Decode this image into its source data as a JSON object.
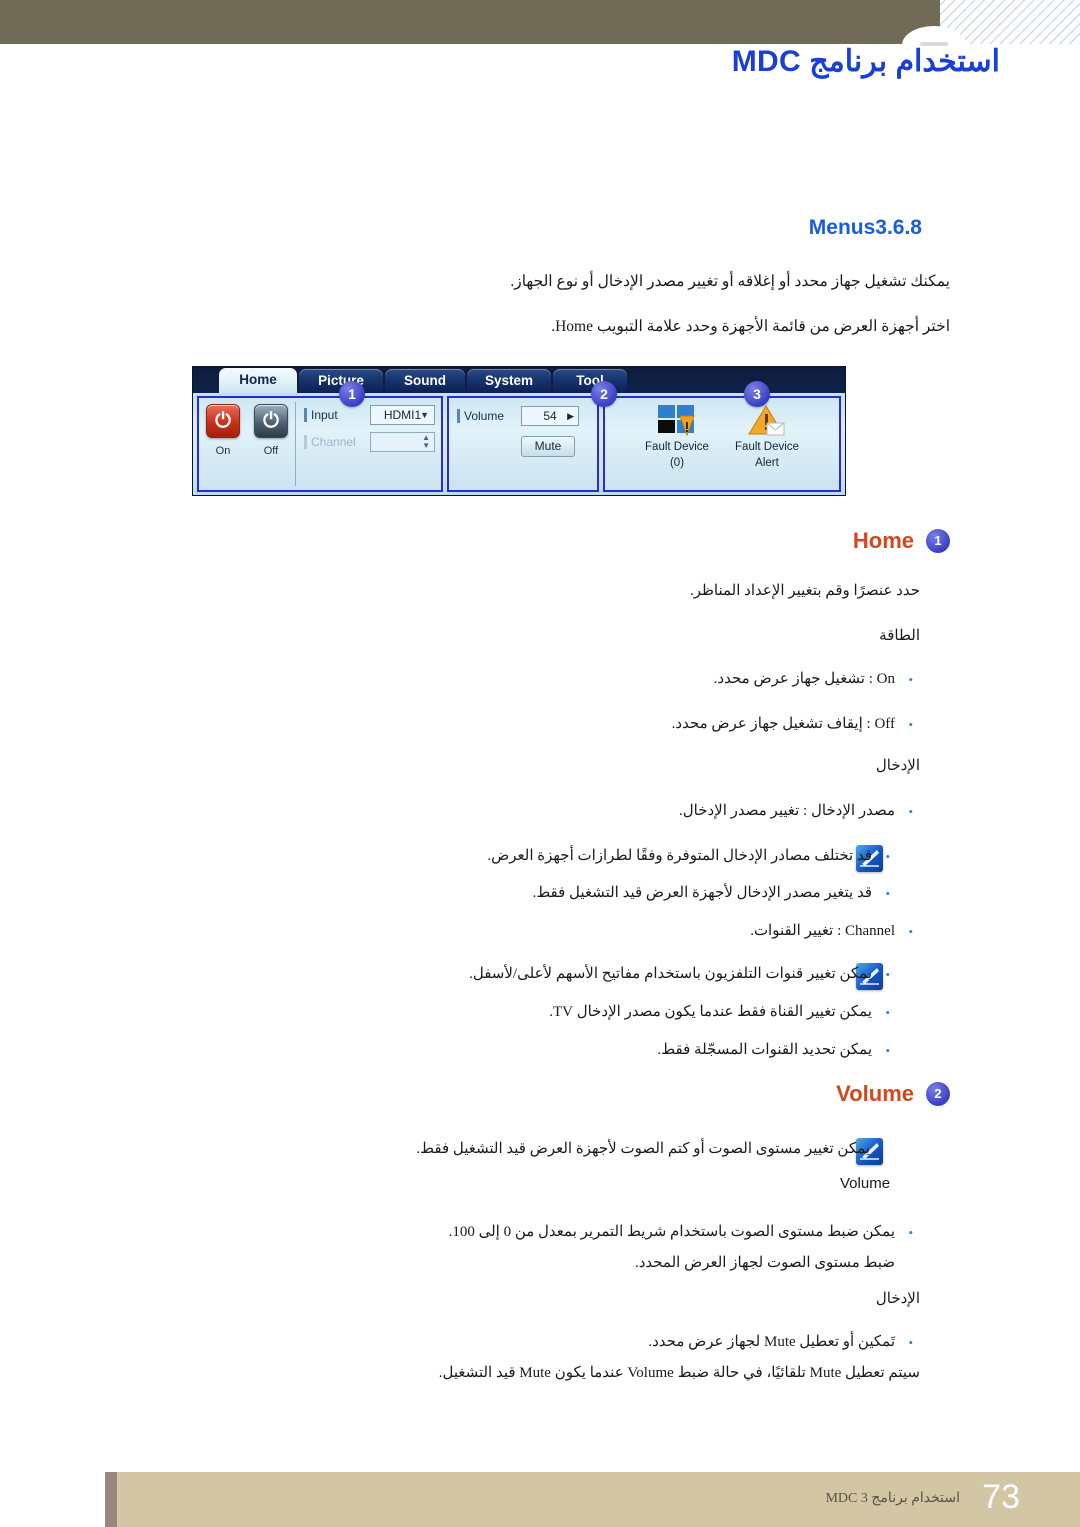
{
  "header": {
    "title": "استخدام برنامج MDC"
  },
  "section": {
    "number": "3.6.8",
    "title": "Menus",
    "intro_1": "يمكنك تشغيل جهاز محدد أو إغلاقه أو تغيير مصدر الإدخال أو نوع الجهاز.",
    "intro_2": "اختر أجهزة العرض من قائمة الأجهزة وحدد علامة التبويب Home."
  },
  "mdc": {
    "tabs": [
      {
        "label": "Home",
        "active": true
      },
      {
        "label": "Picture",
        "active": false
      },
      {
        "label": "Sound",
        "active": false
      },
      {
        "label": "System",
        "active": false
      },
      {
        "label": "Tool",
        "active": false
      }
    ],
    "badges": [
      "1",
      "2",
      "3"
    ],
    "power": {
      "on_label": "On",
      "off_label": "Off",
      "glyph": "power-icon"
    },
    "input_group": {
      "input_label": "Input",
      "input_value": "HDMI1",
      "channel_label": "Channel",
      "channel_value": ""
    },
    "volume_group": {
      "volume_label": "Volume",
      "volume_value": "54",
      "mute_label": "Mute"
    },
    "fault_group": {
      "fault_device_label": "Fault Device",
      "fault_device_count": "(0)",
      "fault_alert_label": "Fault Device",
      "fault_alert_label2": "Alert"
    }
  },
  "home": {
    "heading": "Home",
    "badge": "1",
    "desc": "حدد عنصرًا وقم بتغيير الإعداد المناظر.",
    "power_title": "الطاقة",
    "power_on": "On :  تشغيل جهاز عرض محدد.",
    "power_off": "Off :  إيقاف تشغيل جهاز عرض محدد.",
    "input_title": "الإدخال",
    "input_source": "مصدر الإدخال : تغيير مصدر الإدخال.",
    "note_1": "قد تختلف مصادر الإدخال المتوفرة وفقًا لطرازات أجهزة العرض.",
    "note_2": "قد يتغير مصدر الإدخال لأجهزة العرض قيد التشغيل فقط.",
    "channel": "Channel :  تغيير القنوات.",
    "note_3": "يمكن تغيير قنوات التلفزيون باستخدام مفاتيح الأسهم لأعلى/لأسفل.",
    "note_4": "يمكن تغيير القناة فقط عندما يكون مصدر الإدخال TV.",
    "note_5": "يمكن تحديد القنوات المسجّلة فقط."
  },
  "volume": {
    "heading": "Volume",
    "badge": "2",
    "note": "يمكن تغيير مستوى الصوت أو كتم الصوت لأجهزة العرض قيد التشغيل فقط.",
    "caption": "Volume",
    "bullet_1": "يمكن ضبط مستوى الصوت باستخدام شريط التمرير بمعدل من 0  إلى 100.",
    "sub_1": "ضبط مستوى الصوت لجهاز العرض المحدد.",
    "input_title": "الإدخال",
    "bullet_2": "تَمكين أو تعطيل Mute لجهاز عرض محدد.",
    "sub_2": "سيتم تعطيل Mute تلقائيًا، في حالة ضبط Volume عندما يكون Mute قيد التشغيل."
  },
  "footer": {
    "text": "استخدام برنامج MDC 3",
    "page": "73"
  },
  "colors": {
    "header_bar": "#706b57",
    "title_blue": "#1a3fd4",
    "section_blue": "#1a5ce0",
    "heading_red": "#d4471b",
    "footer_bar": "#d3c6a4",
    "footer_tab": "#97887f",
    "badge_blue": "#3a3fc4",
    "bullet_blue": "#2f7fd4"
  }
}
